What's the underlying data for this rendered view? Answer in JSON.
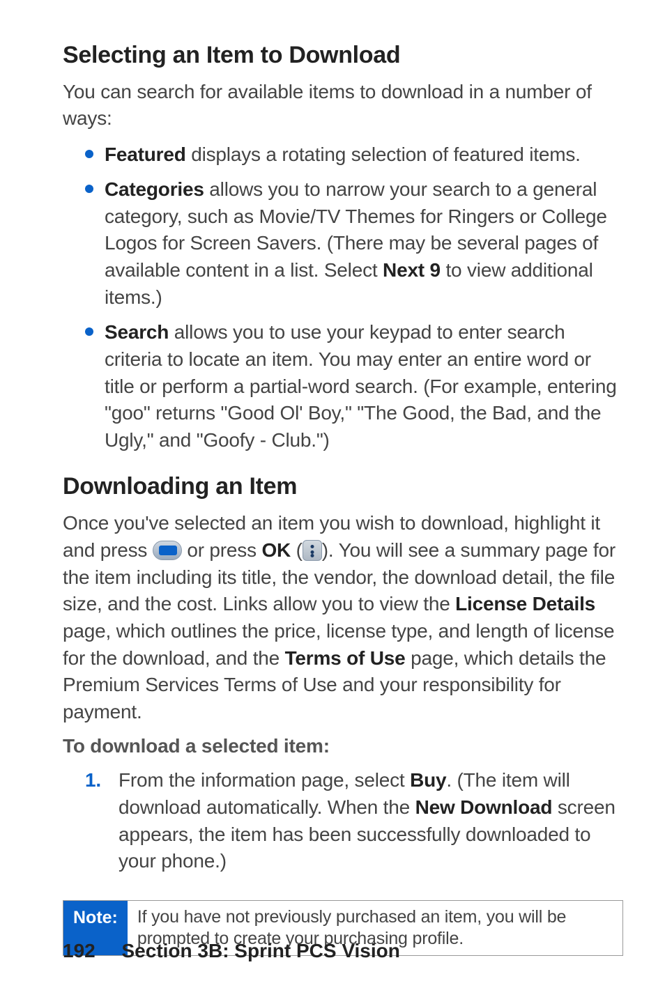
{
  "section1": {
    "heading": "Selecting an Item to Download",
    "intro": "You can search for available items to download in a number of ways:",
    "bullets": [
      {
        "bold": "Featured",
        "text": " displays a rotating selection of featured items."
      },
      {
        "bold": "Categories",
        "text": " allows you to narrow your search to a general category, such as Movie/TV Themes for Ringers or College Logos for Screen Savers. (There may be several pages of available content in a list. Select ",
        "bold2": "Next 9",
        "text2": " to view additional items.)"
      },
      {
        "bold": "Search",
        "text": " allows you to use your keypad to enter search criteria to locate an item. You may enter an entire word or title or perform a partial-word search. (For example, entering \"goo\" returns \"Good Ol' Boy,\" \"The Good, the Bad, and the Ugly,\" and \"Goofy - Club.\")"
      }
    ]
  },
  "section2": {
    "heading": "Downloading an Item",
    "body_pre": "Once you've selected an item you wish to download, highlight it and press ",
    "body_mid1": " or press ",
    "body_ok": "OK",
    "body_mid2": " (",
    "body_mid3": "). You will see a summary page for the item including its title, the vendor, the download detail, the file size, and the cost. Links allow you to view the ",
    "body_bold1": "License Details",
    "body_mid4": " page, which outlines the price, license type, and length of license for the download, and the ",
    "body_bold2": "Terms of Use",
    "body_mid5": " page, which details the Premium Services Terms of Use and your responsibility for payment.",
    "subhead": "To download a selected item:",
    "step1_num": "1.",
    "step1_pre": "From the information page, select ",
    "step1_bold1": "Buy",
    "step1_mid1": ". (The item will download automatically. When the ",
    "step1_bold2": "New Download",
    "step1_mid2": " screen appears, the item has been successfully downloaded to your phone.)"
  },
  "note": {
    "label": "Note:",
    "text": "If you have not previously purchased an item, you will be prompted to create your purchasing profile."
  },
  "footer": {
    "page": "192",
    "section": "Section 3B: Sprint PCS Vision"
  }
}
